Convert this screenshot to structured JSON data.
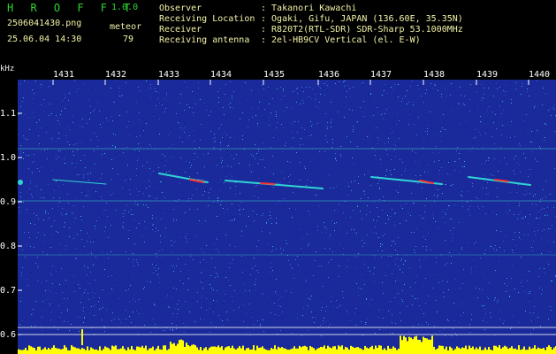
{
  "header": {
    "logo": "H R O F F T",
    "version": "1.0.0",
    "filename": "2506041430.png",
    "meteor_label": "meteor",
    "datetime": "25.06.04 14:30",
    "meteor_count": "79",
    "info": [
      {
        "label": "Observer",
        "value": ": Takanori Kawachi"
      },
      {
        "label": "Receiving Location",
        "value": ": Ogaki, Gifu, JAPAN (136.60E, 35.35N)"
      },
      {
        "label": "Receiver",
        "value": ": R820T2(RTL-SDR) SDR-Sharp 53.1000MHz"
      },
      {
        "label": "Receiving antenna",
        "value": ": 2el-HB9CV Vertical (el. E-W)"
      }
    ]
  },
  "axes": {
    "y_unit": "kHz",
    "x_ticks": [
      "1431",
      "1432",
      "1433",
      "1434",
      "1435",
      "1436",
      "1437",
      "1438",
      "1439",
      "1440"
    ],
    "y_ticks": [
      "1.1",
      "1.0",
      "0.9",
      "0.8",
      "0.7",
      "0.6"
    ]
  },
  "colors": {
    "background": "#1a2a9a",
    "meteor_trace": "#2fd4d4",
    "meteor_core": "#ff3030",
    "signal_bars": "#ffff00"
  }
}
